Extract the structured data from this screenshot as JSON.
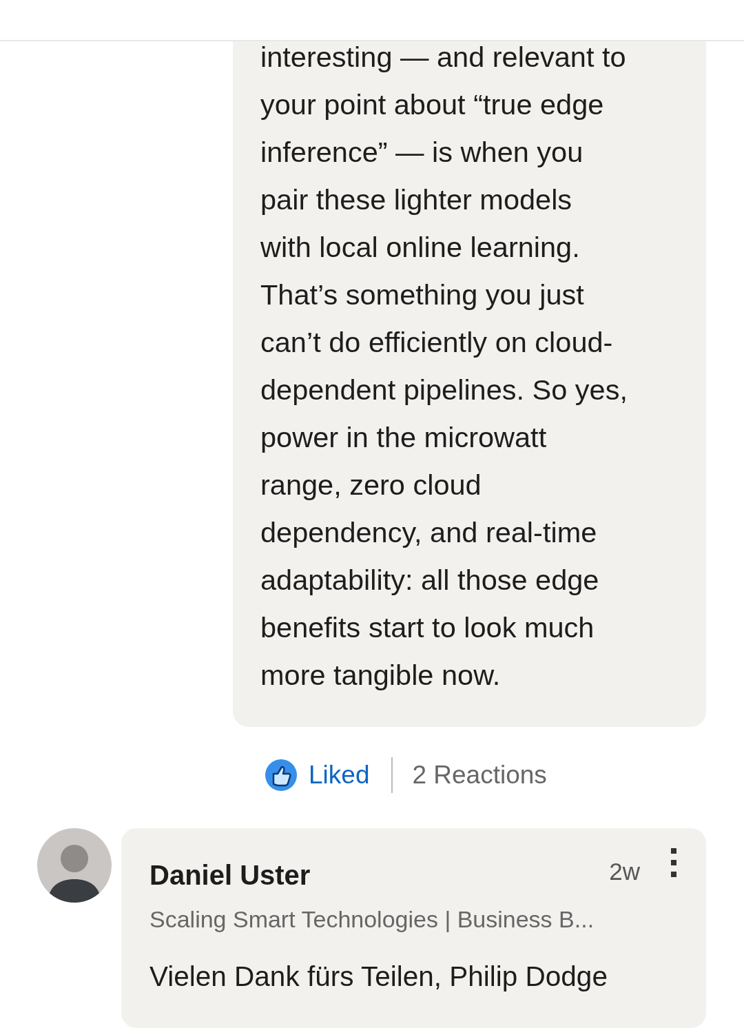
{
  "reply": {
    "lines": [
      "interesting — and relevant to",
      "your point about “true edge",
      "inference” — is when you",
      "pair these lighter models",
      "with local online learning.",
      "That’s something you just",
      "can’t do efficiently on cloud-",
      "dependent pipelines. So yes,",
      "power in the microwatt",
      "range, zero cloud",
      "dependency, and real-time",
      "adaptability: all those edge",
      "benefits start to look much",
      "more tangible now."
    ]
  },
  "reactions": {
    "like_label": "Liked",
    "liked": true,
    "count": "2 Reactions"
  },
  "comment": {
    "author": "Daniel Uster",
    "time": "2w",
    "headline": "Scaling Smart Technologies | Business B...",
    "text": "Vielen Dank fürs Teilen, Philip Dodge"
  }
}
